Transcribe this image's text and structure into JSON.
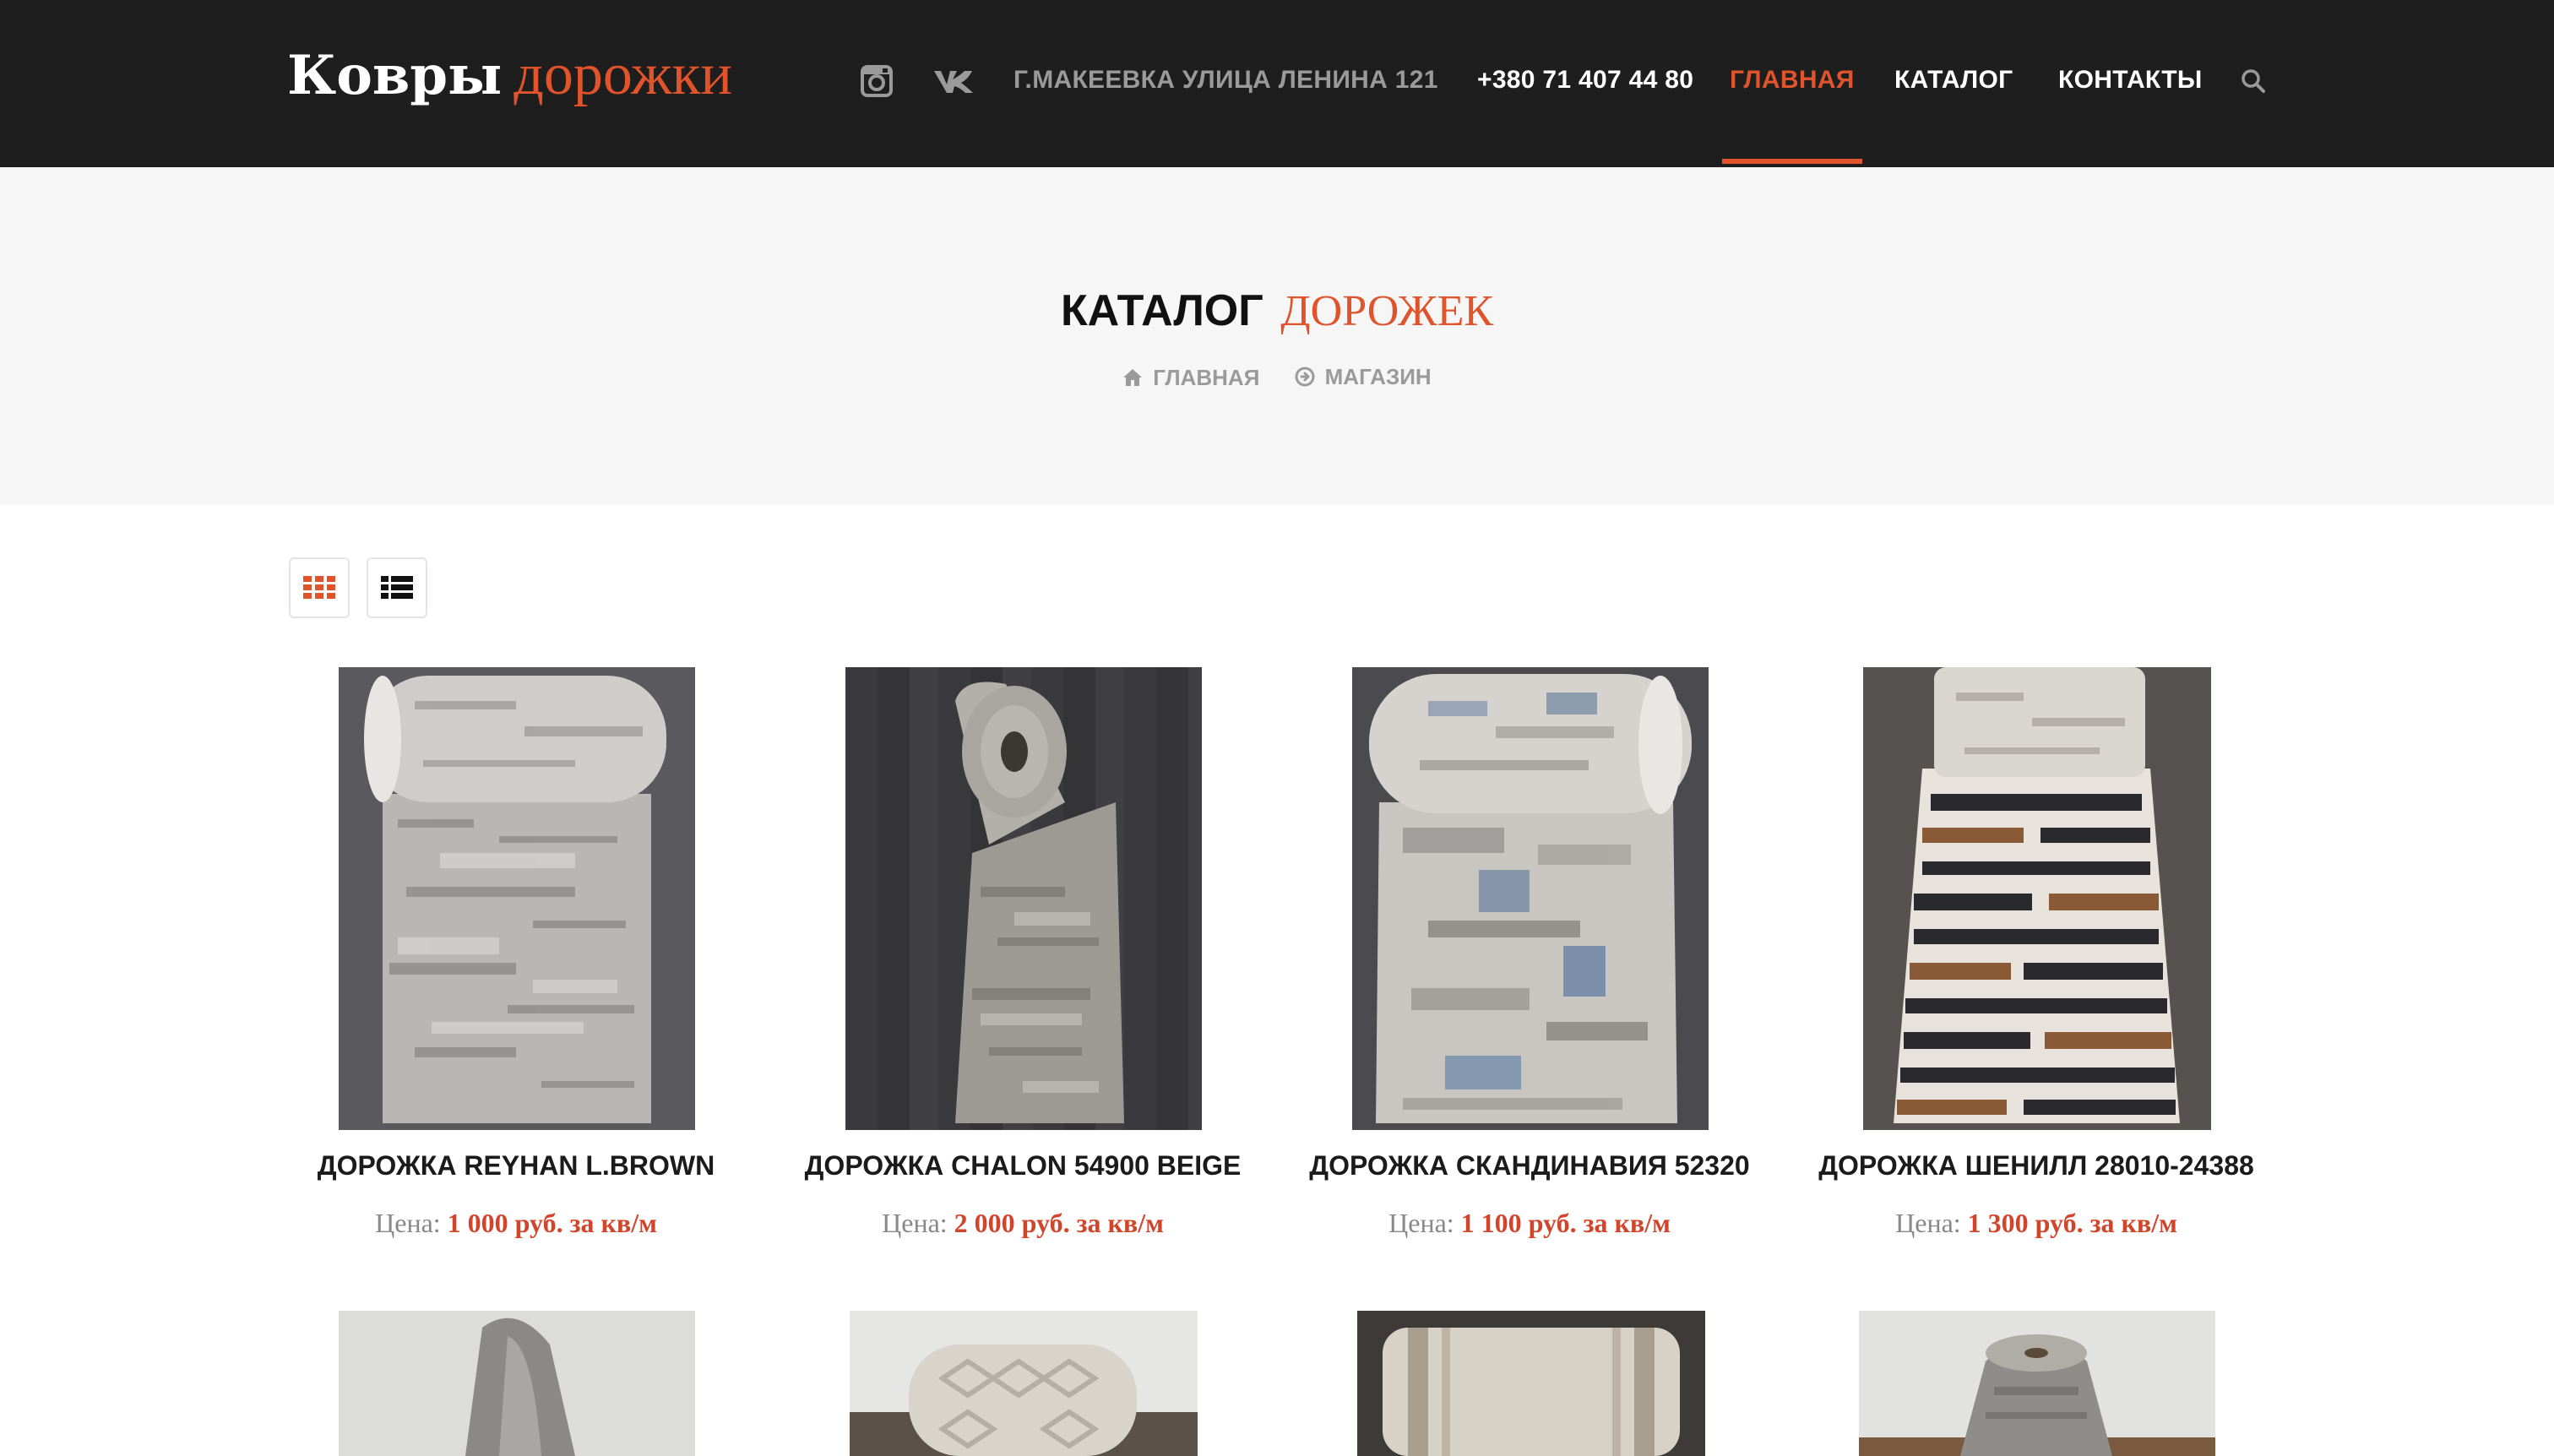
{
  "header": {
    "logo_part1": "Ковры",
    "logo_part2": "дорожки",
    "social": [
      {
        "icon": "instagram-icon"
      },
      {
        "icon": "vk-icon"
      }
    ],
    "address": "Г.МАКЕЕВКА УЛИЦА ЛЕНИНА 121",
    "phone": "+380 71 407 44 80",
    "nav": [
      {
        "label": "ГЛАВНАЯ",
        "active": true
      },
      {
        "label": "КАТАЛОГ",
        "active": false
      },
      {
        "label": "КОНТАКТЫ",
        "active": false
      }
    ],
    "search_icon": "search-icon"
  },
  "title_band": {
    "title_part1": "КАТАЛОГ",
    "title_part2": "ДОРОЖЕК",
    "breadcrumb": [
      {
        "icon": "home-icon",
        "label": "ГЛАВНАЯ"
      },
      {
        "icon": "arrow-circle-right-icon",
        "label": "МАГАЗИН"
      }
    ]
  },
  "view_toggle": {
    "grid_icon": "grid-view-icon",
    "list_icon": "list-view-icon",
    "active": "grid"
  },
  "products": [
    {
      "name": "ДОРОЖКА REYHAN L.BROWN",
      "price_label": "Цена:",
      "price": "1 000 руб. за кв/м"
    },
    {
      "name": "ДОРОЖКА CHALON 54900 BEIGE",
      "price_label": "Цена:",
      "price": "2 000 руб. за кв/м"
    },
    {
      "name": "ДОРОЖКА СКАНДИНАВИЯ 52320",
      "price_label": "Цена:",
      "price": "1 100 руб. за кв/м"
    },
    {
      "name": "ДОРОЖКА ШЕНИЛЛ 28010-24388",
      "price_label": "Цена:",
      "price": "1 300 руб. за кв/м"
    }
  ],
  "colors": {
    "accent": "#e0532b",
    "header_bg": "#1e1e1e",
    "band_bg": "#f6f6f6",
    "price": "#d3452a"
  }
}
